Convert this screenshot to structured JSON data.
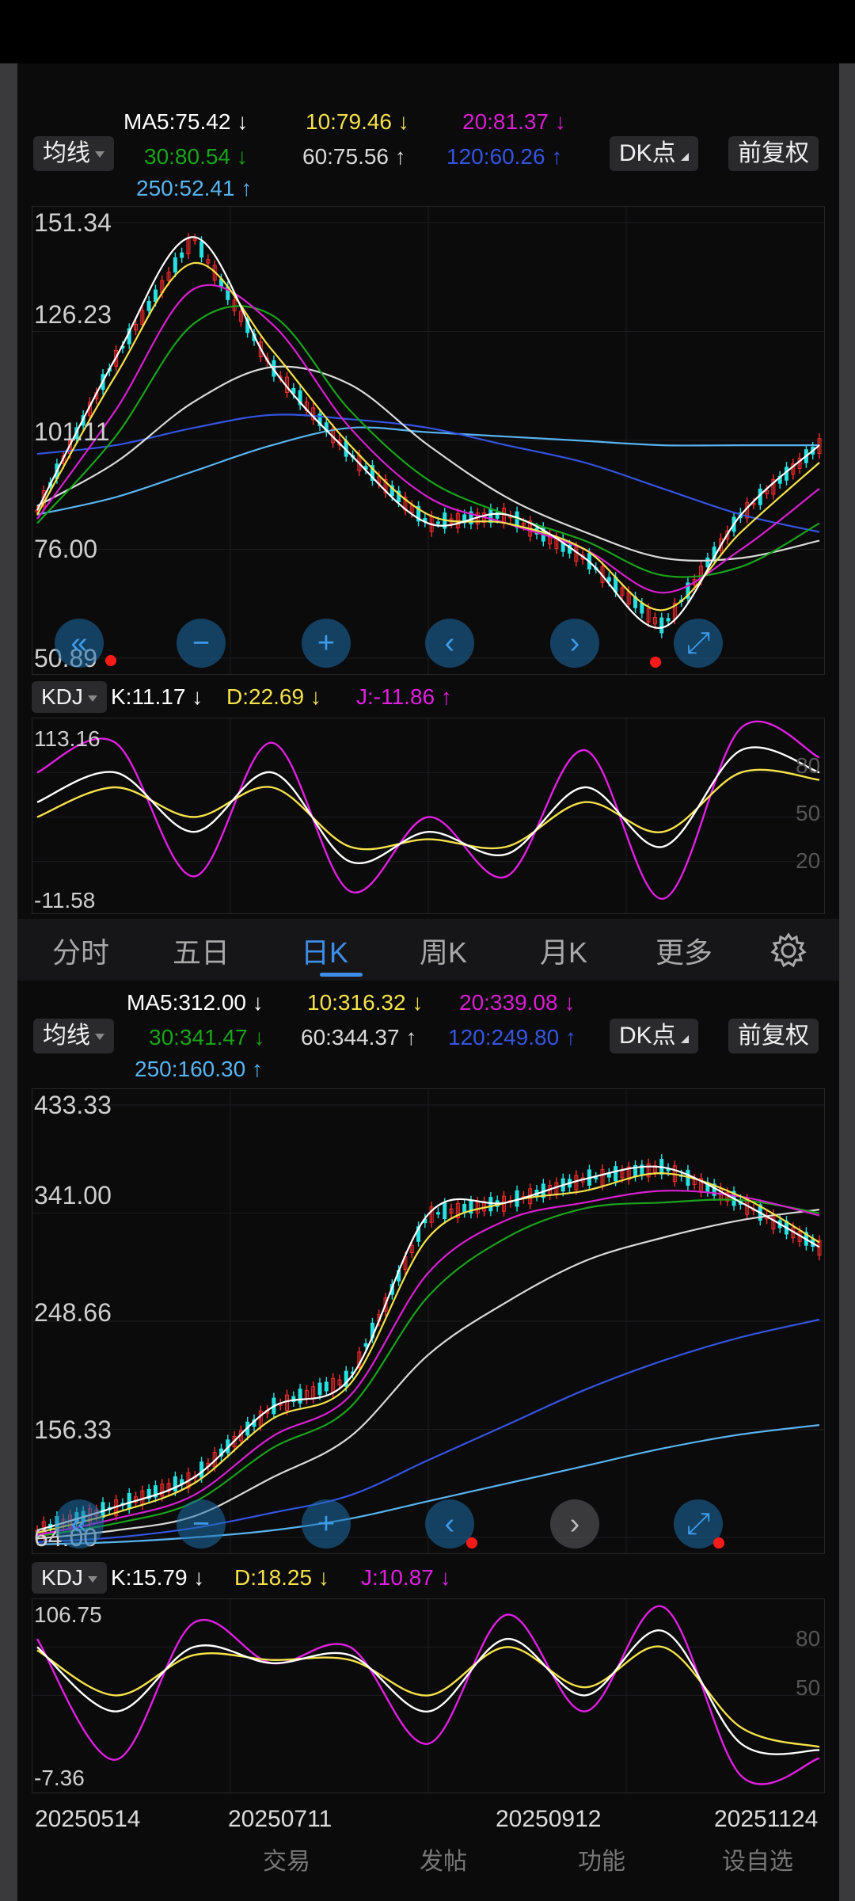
{
  "colors": {
    "ma5": "#ffffff",
    "ma10": "#f5e24a",
    "ma20": "#d81fd0",
    "ma30": "#1aa31a",
    "ma60": "#dadada",
    "ma120": "#3554e0",
    "ma250": "#58b4f0",
    "up": "#f52c2c",
    "down": "#29e0e0",
    "k": "#ffffff",
    "d": "#f5e24a",
    "j": "#e11fe1"
  },
  "tabs": [
    "分时",
    "五日",
    "日K",
    "周K",
    "月K",
    "更多",
    "gear-icon"
  ],
  "active_tab": "日K",
  "top_chart": {
    "header": {
      "ma_btn": "均线",
      "dk_btn": "DK点",
      "adj_btn": "前复权",
      "ma5": "MA5:75.42 ↓",
      "ma10": "10:79.46 ↓",
      "ma20": "20:81.37 ↓",
      "ma30": "30:80.54 ↓",
      "ma60": "60:75.56 ↑",
      "ma120": "120:60.26 ↑",
      "ma250": "250:52.41 ↑"
    },
    "y_labels": [
      "151.34",
      "126.23",
      "101.11",
      "76.00",
      "50.89"
    ],
    "kdj_header": {
      "label": "KDJ",
      "k": "K:11.17 ↓",
      "d": "D:22.69 ↓",
      "j": "J:-11.86 ↑"
    },
    "kdj_labels": [
      "113.16",
      "-11.58",
      "80",
      "50",
      "20"
    ]
  },
  "bottom_chart": {
    "header": {
      "ma_btn": "均线",
      "dk_btn": "DK点",
      "adj_btn": "前复权",
      "ma5": "MA5:312.00 ↓",
      "ma10": "10:316.32 ↓",
      "ma20": "20:339.08 ↓",
      "ma30": "30:341.47 ↓",
      "ma60": "60:344.37 ↑",
      "ma120": "120:249.80 ↑",
      "ma250": "250:160.30 ↑"
    },
    "y_labels": [
      "433.33",
      "341.00",
      "248.66",
      "156.33",
      "64.00"
    ],
    "kdj_header": {
      "label": "KDJ",
      "k": "K:15.79 ↓",
      "d": "D:18.25 ↓",
      "j": "J:10.87 ↓"
    },
    "kdj_labels": [
      "106.75",
      "-7.36",
      "80",
      "50"
    ],
    "dates": [
      "20250514",
      "20250711",
      "20250912",
      "20251124"
    ]
  },
  "bottom_nav": [
    "交易",
    "发帖",
    "功能",
    "设自选"
  ],
  "chart_data": [
    {
      "type": "line",
      "title": "",
      "xlabel": "",
      "ylabel": "",
      "ylim": [
        50.89,
        151.34
      ],
      "legend": "top",
      "x": [
        0,
        10,
        20,
        30,
        40,
        50,
        60,
        70,
        80,
        90,
        100
      ],
      "series": [
        {
          "name": "MA5",
          "values": [
            85,
            120,
            148,
            118,
            98,
            82,
            84,
            74,
            58,
            84,
            100
          ]
        },
        {
          "name": "MA10",
          "values": [
            84,
            116,
            142,
            122,
            100,
            84,
            82,
            76,
            62,
            80,
            96
          ]
        },
        {
          "name": "MA20",
          "values": [
            83,
            108,
            136,
            128,
            104,
            88,
            82,
            76,
            66,
            76,
            90
          ]
        },
        {
          "name": "MA30",
          "values": [
            82,
            102,
            128,
            130,
            108,
            92,
            84,
            78,
            70,
            72,
            82
          ]
        },
        {
          "name": "MA60",
          "values": [
            86,
            96,
            110,
            118,
            114,
            100,
            88,
            80,
            74,
            74,
            78
          ]
        },
        {
          "name": "MA120",
          "values": [
            98,
            100,
            104,
            107,
            106,
            104,
            100,
            96,
            90,
            84,
            80
          ]
        },
        {
          "name": "MA250",
          "values": [
            84,
            88,
            94,
            100,
            104,
            103,
            102,
            101,
            100,
            100,
            100
          ]
        }
      ]
    },
    {
      "type": "line",
      "title": "",
      "xlabel": "",
      "ylabel": "",
      "ylim": [
        -11.58,
        113.16
      ],
      "x": [
        0,
        10,
        20,
        30,
        40,
        50,
        60,
        70,
        80,
        90,
        100
      ],
      "series": [
        {
          "name": "K",
          "values": [
            60,
            80,
            40,
            80,
            20,
            40,
            25,
            70,
            30,
            95,
            80
          ]
        },
        {
          "name": "D",
          "values": [
            50,
            70,
            50,
            70,
            30,
            35,
            30,
            60,
            40,
            80,
            75
          ]
        },
        {
          "name": "J",
          "values": [
            80,
            100,
            10,
            100,
            0,
            50,
            10,
            95,
            -5,
            110,
            90
          ]
        }
      ]
    },
    {
      "type": "line",
      "title": "",
      "xlabel": "",
      "ylabel": "",
      "ylim": [
        64.0,
        433.33
      ],
      "categories": [
        "20250514",
        "20250711",
        "20250912",
        "20251124"
      ],
      "x": [
        0,
        10,
        20,
        30,
        40,
        50,
        60,
        70,
        80,
        90,
        100
      ],
      "series": [
        {
          "name": "MA5",
          "values": [
            70,
            90,
            115,
            175,
            200,
            340,
            350,
            370,
            380,
            350,
            312
          ]
        },
        {
          "name": "MA10",
          "values": [
            68,
            85,
            110,
            165,
            195,
            320,
            350,
            360,
            375,
            355,
            316
          ]
        },
        {
          "name": "MA20",
          "values": [
            66,
            80,
            100,
            150,
            185,
            290,
            335,
            350,
            360,
            355,
            339
          ]
        },
        {
          "name": "MA30",
          "values": [
            65,
            76,
            94,
            140,
            175,
            270,
            320,
            345,
            350,
            352,
            341
          ]
        },
        {
          "name": "MA60",
          "values": [
            63,
            70,
            82,
            115,
            150,
            220,
            265,
            300,
            320,
            335,
            344
          ]
        },
        {
          "name": "MA120",
          "values": [
            60,
            64,
            72,
            85,
            100,
            130,
            160,
            190,
            215,
            235,
            250
          ]
        },
        {
          "name": "MA250",
          "values": [
            58,
            60,
            64,
            70,
            80,
            95,
            110,
            125,
            140,
            152,
            160
          ]
        }
      ]
    },
    {
      "type": "line",
      "title": "",
      "xlabel": "",
      "ylabel": "",
      "ylim": [
        -7.36,
        106.75
      ],
      "x": [
        0,
        10,
        20,
        30,
        40,
        50,
        60,
        70,
        80,
        90,
        100
      ],
      "series": [
        {
          "name": "K",
          "values": [
            80,
            40,
            80,
            70,
            75,
            40,
            85,
            50,
            90,
            20,
            16
          ]
        },
        {
          "name": "D",
          "values": [
            78,
            50,
            75,
            72,
            72,
            50,
            80,
            55,
            80,
            30,
            18
          ]
        },
        {
          "name": "J",
          "values": [
            85,
            10,
            95,
            70,
            80,
            20,
            100,
            40,
            105,
            0,
            11
          ]
        }
      ]
    }
  ]
}
